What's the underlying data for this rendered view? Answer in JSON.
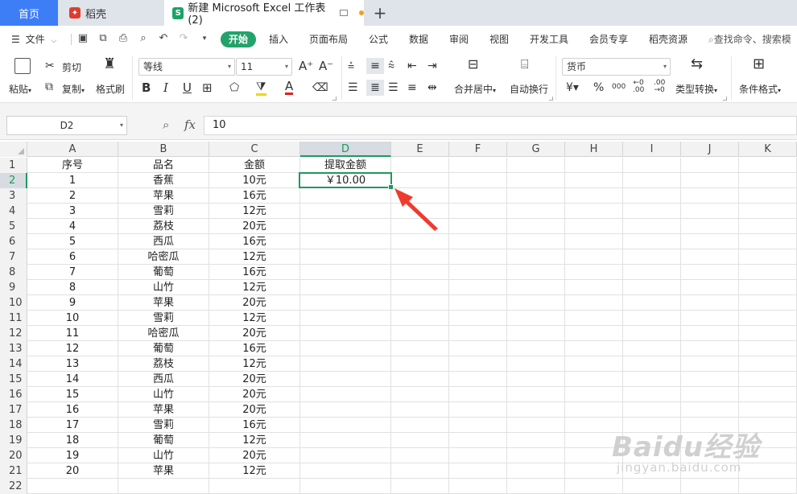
{
  "tabs": {
    "home": "首页",
    "docer": "稻壳",
    "document": "新建 Microsoft Excel 工作表 (2)",
    "new_tab": "+"
  },
  "menu": {
    "file": "文件",
    "items": [
      "开始",
      "插入",
      "页面布局",
      "公式",
      "数据",
      "审阅",
      "视图",
      "开发工具",
      "会员专享",
      "稻壳资源"
    ],
    "search": "查找命令、搜索模"
  },
  "ribbon": {
    "paste": "粘贴",
    "cut": "剪切",
    "copy": "复制",
    "format_painter": "格式刷",
    "font_name": "等线",
    "font_size": "11",
    "merge_center": "合并居中",
    "auto_wrap": "自动换行",
    "number_format": "货币",
    "type_convert": "类型转换",
    "cond_format": "条件格式"
  },
  "formula_bar": {
    "name_box": "D2",
    "fx_label": "fx",
    "formula": "10"
  },
  "sheet": {
    "columns": [
      "A",
      "B",
      "C",
      "D",
      "E",
      "F",
      "G",
      "H",
      "I",
      "J",
      "K"
    ],
    "active_column": "D",
    "active_row": 2,
    "header_row": [
      "序号",
      "品名",
      "金额",
      "提取金额"
    ],
    "d2_value": "￥10.00",
    "rows": [
      [
        "1",
        "香蕉",
        "10元"
      ],
      [
        "2",
        "苹果",
        "16元"
      ],
      [
        "3",
        "雪莉",
        "12元"
      ],
      [
        "4",
        "荔枝",
        "20元"
      ],
      [
        "5",
        "西瓜",
        "16元"
      ],
      [
        "6",
        "哈密瓜",
        "12元"
      ],
      [
        "7",
        "葡萄",
        "16元"
      ],
      [
        "8",
        "山竹",
        "12元"
      ],
      [
        "9",
        "苹果",
        "20元"
      ],
      [
        "10",
        "雪莉",
        "12元"
      ],
      [
        "11",
        "哈密瓜",
        "20元"
      ],
      [
        "12",
        "葡萄",
        "16元"
      ],
      [
        "13",
        "荔枝",
        "12元"
      ],
      [
        "14",
        "西瓜",
        "20元"
      ],
      [
        "15",
        "山竹",
        "20元"
      ],
      [
        "16",
        "苹果",
        "20元"
      ],
      [
        "17",
        "雪莉",
        "16元"
      ],
      [
        "18",
        "葡萄",
        "12元"
      ],
      [
        "19",
        "山竹",
        "20元"
      ],
      [
        "20",
        "苹果",
        "12元"
      ]
    ],
    "row_numbers": [
      "1",
      "2",
      "3",
      "4",
      "5",
      "6",
      "7",
      "8",
      "9",
      "10",
      "11",
      "12",
      "13",
      "14",
      "15",
      "16",
      "17",
      "18",
      "19",
      "20",
      "21",
      "22"
    ]
  },
  "annotation": {
    "arrow_color": "#f03a2e"
  },
  "watermark": {
    "logo": "Baidu经验",
    "sub": "jingyan.baidu.com"
  }
}
